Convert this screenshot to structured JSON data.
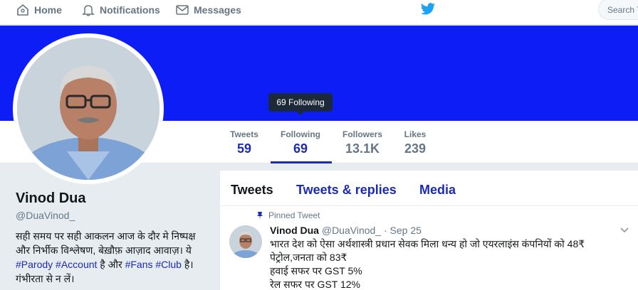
{
  "nav": {
    "home": "Home",
    "notifications": "Notifications",
    "messages": "Messages",
    "search_placeholder": "Search Twitter"
  },
  "colors": {
    "banner": "#0c1df5",
    "accent": "#1c2bb3",
    "twitter_blue": "#1da1f2"
  },
  "stats": {
    "tweets_label": "Tweets",
    "tweets_value": "59",
    "following_label": "Following",
    "following_value": "69",
    "followers_label": "Followers",
    "followers_value": "13.1K",
    "likes_label": "Likes",
    "likes_value": "239"
  },
  "tooltip": "69 Following",
  "profile": {
    "name": "Vinod Dua",
    "handle": "@DuaVinod_",
    "bio_1": "सही समय पर सही आकलन आज के दौर मे निष्पक्ष और निर्भीक विश्लेषण, बेख़ौफ़ आज़ाद आवाज़। ये ",
    "bio_tag1": "#Parody",
    "bio_sp1": " ",
    "bio_tag2": "#Account",
    "bio_2": " है और ",
    "bio_tag3": "#Fans",
    "bio_nl": " ",
    "bio_tag4": "#Club",
    "bio_3": " है। गंभीरता से न लें।"
  },
  "tabs": {
    "tweets": "Tweets",
    "replies": "Tweets & replies",
    "media": "Media"
  },
  "pinned_tweet": {
    "pinned_label": "Pinned Tweet",
    "author": "Vinod Dua",
    "handle": "@DuaVinod_",
    "sep": " · ",
    "date": "Sep 25",
    "line1": "भारत देश को ऐसा अर्थशास्त्री प्रधान सेवक मिला धन्य हो जो एयरलाइंस कंपनियों को 48₹",
    "line2": "पेट्रोल,जनता को 83₹",
    "line3": "हवाई सफर पर GST 5%",
    "line4": "रेल सफर पर GST 12%"
  },
  "icons": {
    "home": "home-icon",
    "notifications": "bell-icon",
    "messages": "envelope-icon",
    "logo": "twitter-bird-icon",
    "pin": "pin-icon",
    "caret": "chevron-down-icon"
  }
}
